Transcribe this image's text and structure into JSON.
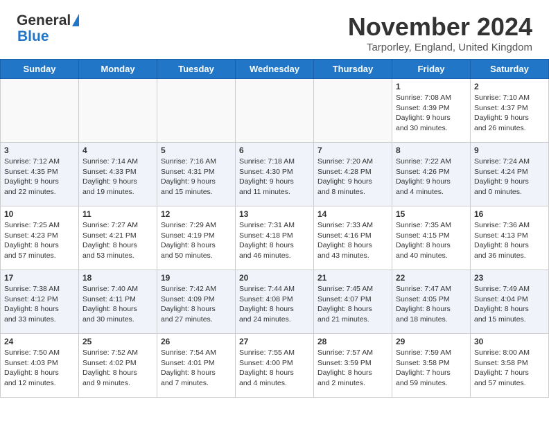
{
  "header": {
    "logo_line1": "General",
    "logo_line2": "Blue",
    "month": "November 2024",
    "location": "Tarporley, England, United Kingdom"
  },
  "weekdays": [
    "Sunday",
    "Monday",
    "Tuesday",
    "Wednesday",
    "Thursday",
    "Friday",
    "Saturday"
  ],
  "weeks": [
    [
      {
        "day": "",
        "info": ""
      },
      {
        "day": "",
        "info": ""
      },
      {
        "day": "",
        "info": ""
      },
      {
        "day": "",
        "info": ""
      },
      {
        "day": "",
        "info": ""
      },
      {
        "day": "1",
        "info": "Sunrise: 7:08 AM\nSunset: 4:39 PM\nDaylight: 9 hours\nand 30 minutes."
      },
      {
        "day": "2",
        "info": "Sunrise: 7:10 AM\nSunset: 4:37 PM\nDaylight: 9 hours\nand 26 minutes."
      }
    ],
    [
      {
        "day": "3",
        "info": "Sunrise: 7:12 AM\nSunset: 4:35 PM\nDaylight: 9 hours\nand 22 minutes."
      },
      {
        "day": "4",
        "info": "Sunrise: 7:14 AM\nSunset: 4:33 PM\nDaylight: 9 hours\nand 19 minutes."
      },
      {
        "day": "5",
        "info": "Sunrise: 7:16 AM\nSunset: 4:31 PM\nDaylight: 9 hours\nand 15 minutes."
      },
      {
        "day": "6",
        "info": "Sunrise: 7:18 AM\nSunset: 4:30 PM\nDaylight: 9 hours\nand 11 minutes."
      },
      {
        "day": "7",
        "info": "Sunrise: 7:20 AM\nSunset: 4:28 PM\nDaylight: 9 hours\nand 8 minutes."
      },
      {
        "day": "8",
        "info": "Sunrise: 7:22 AM\nSunset: 4:26 PM\nDaylight: 9 hours\nand 4 minutes."
      },
      {
        "day": "9",
        "info": "Sunrise: 7:24 AM\nSunset: 4:24 PM\nDaylight: 9 hours\nand 0 minutes."
      }
    ],
    [
      {
        "day": "10",
        "info": "Sunrise: 7:25 AM\nSunset: 4:23 PM\nDaylight: 8 hours\nand 57 minutes."
      },
      {
        "day": "11",
        "info": "Sunrise: 7:27 AM\nSunset: 4:21 PM\nDaylight: 8 hours\nand 53 minutes."
      },
      {
        "day": "12",
        "info": "Sunrise: 7:29 AM\nSunset: 4:19 PM\nDaylight: 8 hours\nand 50 minutes."
      },
      {
        "day": "13",
        "info": "Sunrise: 7:31 AM\nSunset: 4:18 PM\nDaylight: 8 hours\nand 46 minutes."
      },
      {
        "day": "14",
        "info": "Sunrise: 7:33 AM\nSunset: 4:16 PM\nDaylight: 8 hours\nand 43 minutes."
      },
      {
        "day": "15",
        "info": "Sunrise: 7:35 AM\nSunset: 4:15 PM\nDaylight: 8 hours\nand 40 minutes."
      },
      {
        "day": "16",
        "info": "Sunrise: 7:36 AM\nSunset: 4:13 PM\nDaylight: 8 hours\nand 36 minutes."
      }
    ],
    [
      {
        "day": "17",
        "info": "Sunrise: 7:38 AM\nSunset: 4:12 PM\nDaylight: 8 hours\nand 33 minutes."
      },
      {
        "day": "18",
        "info": "Sunrise: 7:40 AM\nSunset: 4:11 PM\nDaylight: 8 hours\nand 30 minutes."
      },
      {
        "day": "19",
        "info": "Sunrise: 7:42 AM\nSunset: 4:09 PM\nDaylight: 8 hours\nand 27 minutes."
      },
      {
        "day": "20",
        "info": "Sunrise: 7:44 AM\nSunset: 4:08 PM\nDaylight: 8 hours\nand 24 minutes."
      },
      {
        "day": "21",
        "info": "Sunrise: 7:45 AM\nSunset: 4:07 PM\nDaylight: 8 hours\nand 21 minutes."
      },
      {
        "day": "22",
        "info": "Sunrise: 7:47 AM\nSunset: 4:05 PM\nDaylight: 8 hours\nand 18 minutes."
      },
      {
        "day": "23",
        "info": "Sunrise: 7:49 AM\nSunset: 4:04 PM\nDaylight: 8 hours\nand 15 minutes."
      }
    ],
    [
      {
        "day": "24",
        "info": "Sunrise: 7:50 AM\nSunset: 4:03 PM\nDaylight: 8 hours\nand 12 minutes."
      },
      {
        "day": "25",
        "info": "Sunrise: 7:52 AM\nSunset: 4:02 PM\nDaylight: 8 hours\nand 9 minutes."
      },
      {
        "day": "26",
        "info": "Sunrise: 7:54 AM\nSunset: 4:01 PM\nDaylight: 8 hours\nand 7 minutes."
      },
      {
        "day": "27",
        "info": "Sunrise: 7:55 AM\nSunset: 4:00 PM\nDaylight: 8 hours\nand 4 minutes."
      },
      {
        "day": "28",
        "info": "Sunrise: 7:57 AM\nSunset: 3:59 PM\nDaylight: 8 hours\nand 2 minutes."
      },
      {
        "day": "29",
        "info": "Sunrise: 7:59 AM\nSunset: 3:58 PM\nDaylight: 7 hours\nand 59 minutes."
      },
      {
        "day": "30",
        "info": "Sunrise: 8:00 AM\nSunset: 3:58 PM\nDaylight: 7 hours\nand 57 minutes."
      }
    ]
  ],
  "alt_rows": [
    1,
    3
  ]
}
